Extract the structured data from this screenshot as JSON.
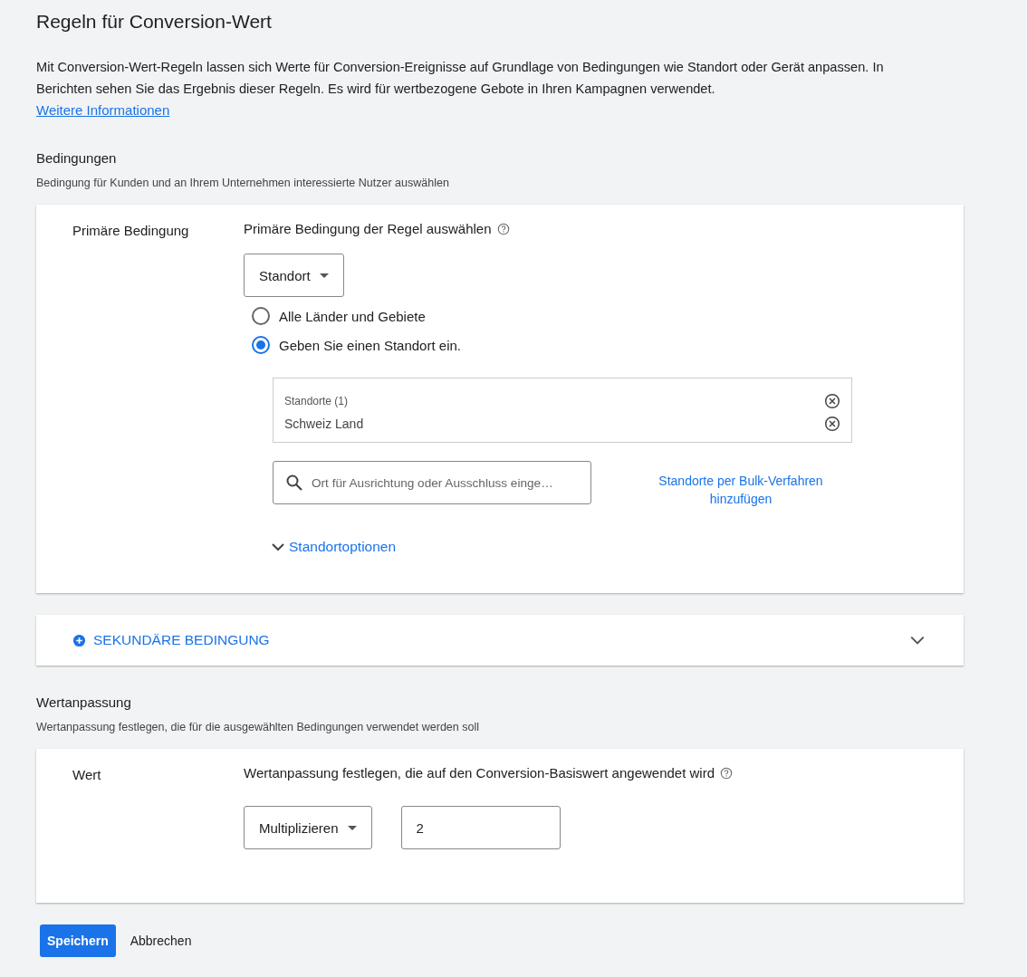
{
  "title": "Regeln für Conversion-Wert",
  "intro": {
    "text": "Mit Conversion-Wert-Regeln lassen sich Werte für Conversion-Ereignisse auf Grundlage von Bedingungen wie Standort oder Gerät anpassen. In Berichten sehen Sie das Ergebnis dieser Regeln. Es wird für wertbezogene Gebote in Ihren Kampagnen verwendet.",
    "link": "Weitere Informationen"
  },
  "conditions": {
    "heading": "Bedingungen",
    "subtitle": "Bedingung für Kunden und an Ihrem Unternehmen interessierte Nutzer auswählen",
    "primary": {
      "label": "Primäre Bedingung",
      "prompt": "Primäre Bedingung der Regel auswählen",
      "dropdown": "Standort",
      "radios": [
        {
          "label": "Alle Länder und Gebiete",
          "selected": false
        },
        {
          "label": "Geben Sie einen Standort ein.",
          "selected": true
        }
      ],
      "locations": {
        "header": "Standorte (1)",
        "items": [
          "Schweiz Land"
        ]
      },
      "search": {
        "placeholder": "Ort für Ausrichtung oder Ausschluss einge…"
      },
      "bulk_link": "Standorte per Bulk-Verfahren hinzufügen",
      "options": {
        "label": "Standortoptionen",
        "expanded": false
      }
    },
    "secondary": {
      "label": "SEKUNDÄRE BEDINGUNG",
      "expanded": false
    }
  },
  "adjustment": {
    "heading": "Wertanpassung",
    "subtitle": "Wertanpassung festlegen, die für die ausgewählten Bedingungen verwendet werden soll",
    "label": "Wert",
    "prompt": "Wertanpassung festlegen, die auf den Conversion-Basiswert angewendet wird",
    "dropdown": "Multiplizieren",
    "value": "2"
  },
  "buttons": {
    "save": "Speichern",
    "cancel": "Abbrechen"
  }
}
